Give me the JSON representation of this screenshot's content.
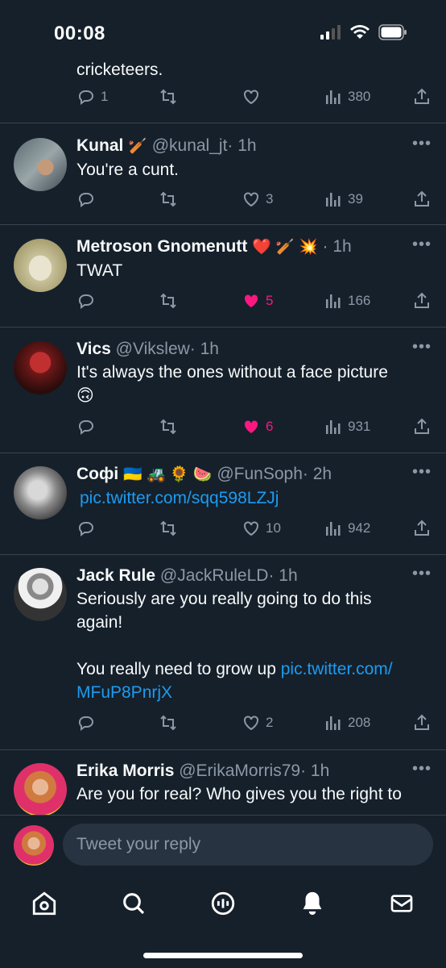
{
  "status": {
    "time": "00:08"
  },
  "partial_tweet": {
    "text": "cricketeers.",
    "replies": "1",
    "retweets": "",
    "likes": "",
    "views": "380"
  },
  "tweets": [
    {
      "name": "Kunal",
      "emoji": "🏏",
      "handle": "@kunal_jt",
      "time": "· 1h",
      "text": "You're a cunt.",
      "replies": "",
      "retweets": "",
      "likes": "3",
      "views": "39",
      "liked": false
    },
    {
      "name": "Metroson Gnomenutt",
      "emoji": "❤️ 🏏 💥",
      "handle": "",
      "time": "· 1h",
      "text": "TWAT",
      "replies": "",
      "retweets": "",
      "likes": "5",
      "views": "166",
      "liked": true
    },
    {
      "name": "Vics",
      "emoji": "",
      "handle": "@Vikslew",
      "time": "· 1h",
      "text": "It's always the ones without a face picture",
      "text_emoji": "🙃",
      "replies": "",
      "retweets": "",
      "likes": "6",
      "views": "931",
      "liked": true
    },
    {
      "name": "Софі",
      "emoji": "🇺🇦 🚜 🌻 🍉",
      "handle": "@FunSoph",
      "time": "· 2h",
      "link": "pic.twitter.com/sqq598LZJj",
      "replies": "",
      "retweets": "",
      "likes": "10",
      "views": "942",
      "liked": false
    },
    {
      "name": "Jack Rule",
      "emoji": "",
      "handle": "@JackRuleLD",
      "time": "· 1h",
      "text_line1": "Seriously are you really going to do this",
      "text_line2": "again!",
      "text_line3": "You really need to grow up",
      "link_part1": "pic.twitter.com/",
      "link_part2": "MFuP8PnrjX",
      "replies": "",
      "retweets": "",
      "likes": "2",
      "views": "208",
      "liked": false
    },
    {
      "name": "Erika Morris",
      "emoji": "",
      "handle": "@ErikaMorris79",
      "time": "· 1h",
      "text": "Are you for real? Who gives you the right to"
    }
  ],
  "more_label": "•••",
  "reply": {
    "placeholder": "Tweet your reply"
  },
  "colors": {
    "background": "#15202b",
    "accent": "#1d9bf0",
    "like": "#f91880",
    "muted": "#8b98a5"
  },
  "tabs": [
    "home-icon",
    "search-icon",
    "spaces-icon",
    "notifications-icon",
    "messages-icon"
  ]
}
